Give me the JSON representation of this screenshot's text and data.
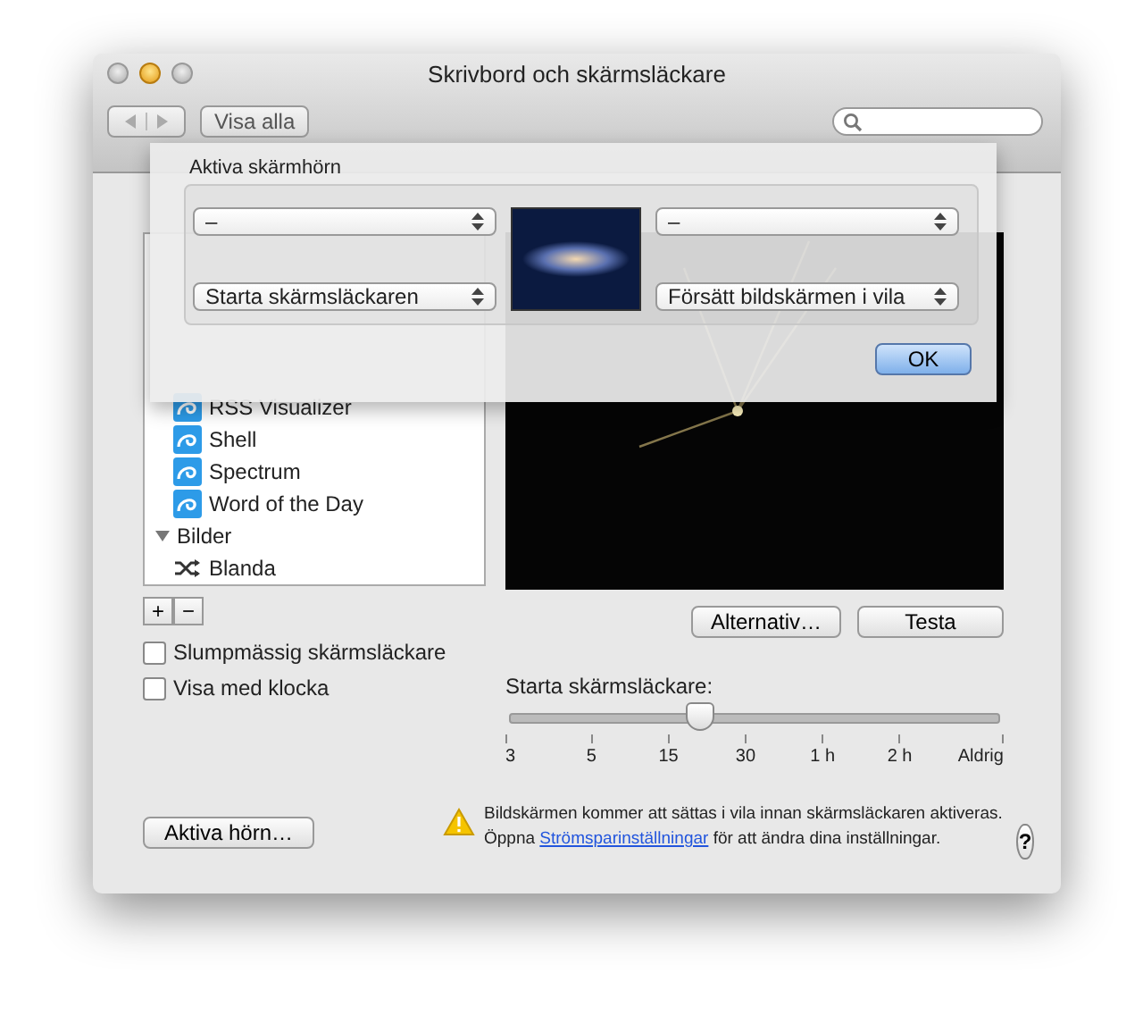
{
  "window": {
    "title": "Skrivbord och skärmsläckare"
  },
  "toolbar": {
    "show_all": "Visa alla"
  },
  "screensavers": {
    "items": [
      {
        "label": "RSS Visualizer",
        "kind": "saver"
      },
      {
        "label": "Shell",
        "kind": "saver"
      },
      {
        "label": "Spectrum",
        "kind": "saver"
      },
      {
        "label": "Word of the Day",
        "kind": "saver"
      },
      {
        "label": "Bilder",
        "kind": "group",
        "expanded": true
      },
      {
        "label": "Blanda",
        "kind": "shuffle"
      }
    ]
  },
  "list_buttons": [
    "+",
    "−"
  ],
  "checkboxes": [
    {
      "label": "Slumpmässig skärmsläckare",
      "checked": false
    },
    {
      "label": "Visa med klocka",
      "checked": false
    }
  ],
  "preview_buttons": [
    "Alternativ…",
    "Testa"
  ],
  "start_slider": {
    "label": "Starta skärmsläckare:",
    "level": 0.39,
    "ticks": [
      "3",
      "5",
      "15",
      "30",
      "1 h",
      "2 h",
      "Aldrig"
    ]
  },
  "hot_corners_button": "Aktiva hörn…",
  "warning": {
    "line1": "Bildskärmen kommer att sättas i vila innan skärmsläckaren aktiveras.",
    "before": "Öppna ",
    "link": "Strömsparinställningar",
    "after": " för att ändra dina inställningar."
  },
  "help_button": "?",
  "sheet": {
    "title": "Aktiva skärmhörn",
    "corners": [
      {
        "value": "–"
      },
      {
        "value": "–"
      },
      {
        "value": "Starta skärmsläckaren"
      },
      {
        "value": "Försätt bildskärmen i vila"
      }
    ],
    "ok": "OK"
  }
}
